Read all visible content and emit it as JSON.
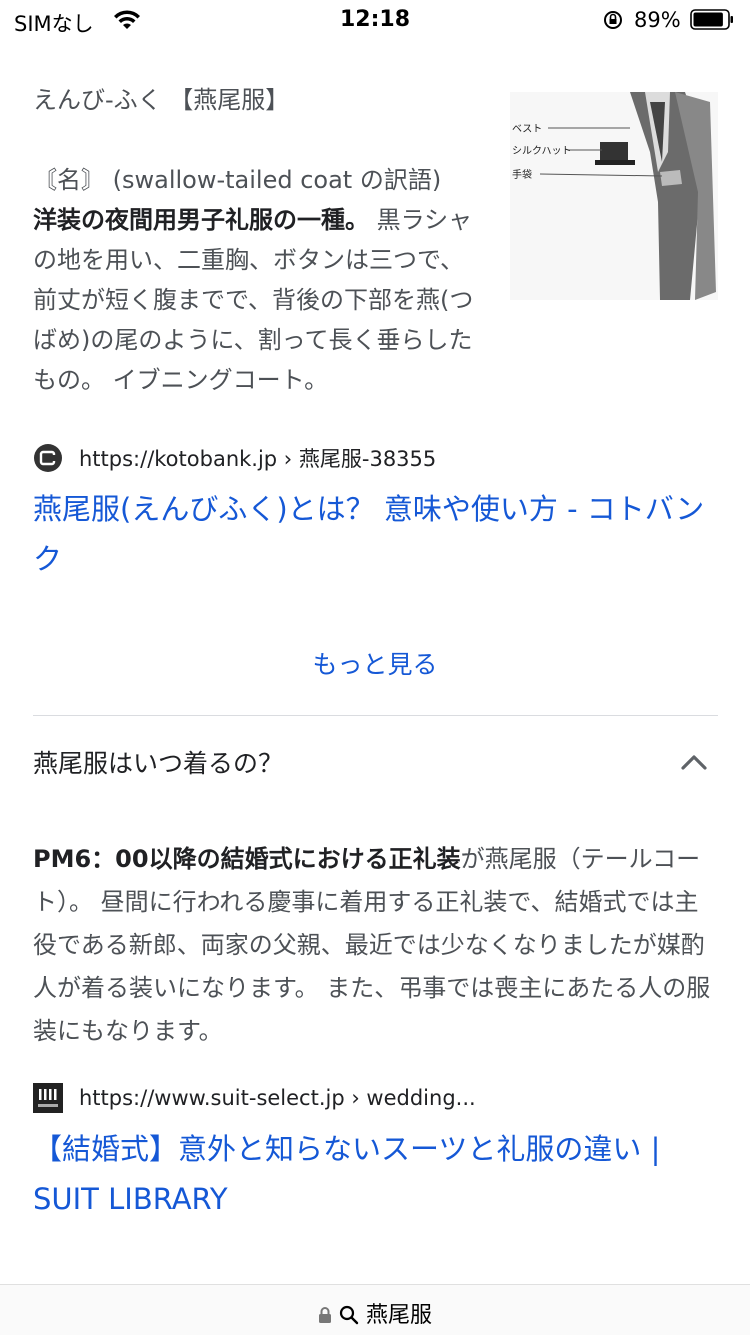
{
  "status": {
    "carrier": "SIMなし",
    "time": "12:18",
    "battery": "89%",
    "battery_level": 0.89
  },
  "result1": {
    "term": "えんび-ふく 【燕尾服】",
    "pos": "〘名〙 (swallow-tailed coat の訳語)",
    "bold": "洋装の夜間用男子礼服の一種。",
    "body": " 黒ラシャの地を用い、二重胸、ボタンは三つで、前丈が短く腹までで、背後の下部を燕(つばめ)の尾のように、割って長く垂らしたもの。 イブニングコート。",
    "image_labels": [
      "ベスト",
      "シルクハット",
      "手袋"
    ],
    "source_url": "https://kotobank.jp › 燕尾服-38355",
    "title": "燕尾服(えんびふく)とは？ 意味や使い方 - コトバンク"
  },
  "more_label": "もっと見る",
  "faq": {
    "question": "燕尾服はいつ着るの？",
    "answer_bold": "PM6：00以降の結婚式における正礼装",
    "answer_rest": "が燕尾服（テールコート）。 昼間に行われる慶事に着用する正礼装で、結婚式では主役である新郎、両家の父親、最近では少なくなりましたが媒酌人が着る装いになります。 また、弔事では喪主にあたる人の服装にもなります。",
    "source_url": "https://www.suit-select.jp › wedding...",
    "title": "【結婚式】意外と知らないスーツと礼服の違い | SUIT LIBRARY"
  },
  "bottom": {
    "query": "燕尾服"
  },
  "colors": {
    "link": "#1558d6",
    "text": "#4d5156"
  }
}
